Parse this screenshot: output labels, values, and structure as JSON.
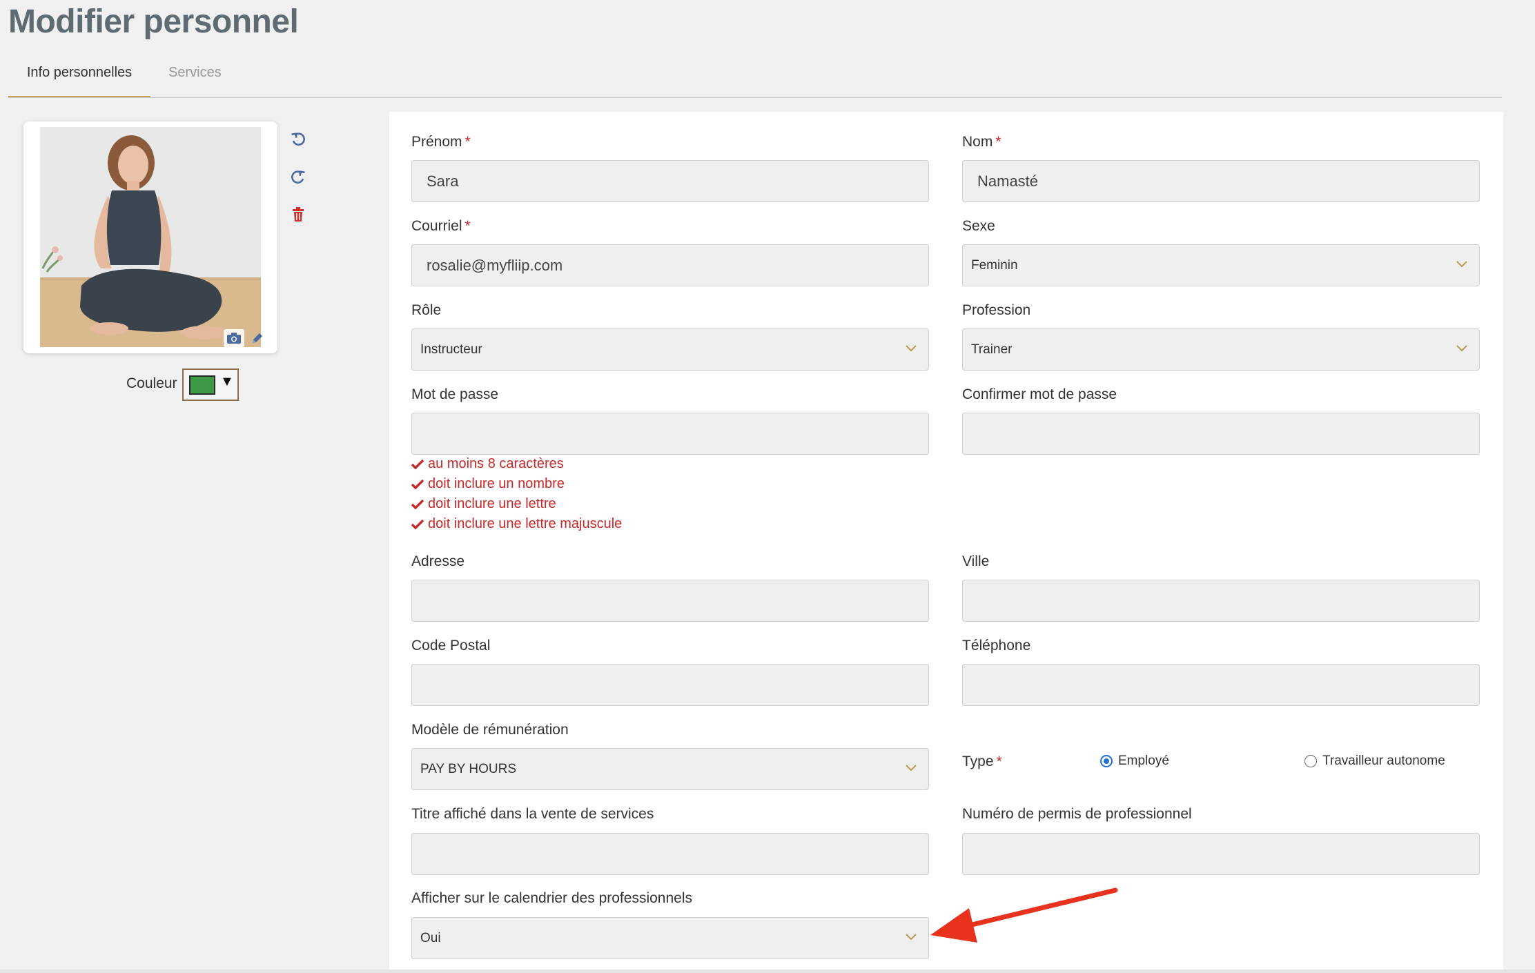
{
  "page_title": "Modifier personnel",
  "tabs": [
    {
      "label": "Info personnelles",
      "active": true
    },
    {
      "label": "Services",
      "active": false
    }
  ],
  "photo": {
    "icons": [
      "rotate-left-icon",
      "rotate-right-icon",
      "trash-icon",
      "camera-icon",
      "pencil-icon"
    ]
  },
  "couleur": {
    "label": "Couleur",
    "value": "#3f9a48"
  },
  "form": {
    "prenom": {
      "label": "Prénom",
      "required_mark": "*",
      "value": "Sara"
    },
    "nom": {
      "label": "Nom",
      "required_mark": "*",
      "value": "Namasté"
    },
    "courriel": {
      "label": "Courriel",
      "required_mark": "*",
      "value": "rosalie@myfliip.com"
    },
    "sexe": {
      "label": "Sexe",
      "value": "Feminin"
    },
    "role": {
      "label": "Rôle",
      "value": "Instructeur"
    },
    "profession": {
      "label": "Profession",
      "value": "Trainer"
    },
    "mot_de_passe": {
      "label": "Mot de passe",
      "value": ""
    },
    "confirmer_mot_de_passe": {
      "label": "Confirmer mot de passe",
      "value": ""
    },
    "password_rules": [
      "au moins 8 caractères",
      "doit inclure un nombre",
      "doit inclure une lettre",
      "doit inclure une lettre majuscule"
    ],
    "adresse": {
      "label": "Adresse",
      "value": ""
    },
    "ville": {
      "label": "Ville",
      "value": ""
    },
    "code_postal": {
      "label": "Code Postal",
      "value": ""
    },
    "telephone": {
      "label": "Téléphone",
      "value": ""
    },
    "modele_remuneration": {
      "label": "Modèle de rémunération",
      "value": "PAY BY HOURS"
    },
    "type": {
      "label": "Type",
      "required_mark": "*",
      "options": [
        {
          "label": "Employé",
          "selected": true
        },
        {
          "label": "Travailleur autonome",
          "selected": false
        }
      ]
    },
    "titre_affiche": {
      "label": "Titre affiché dans la vente de services",
      "value": ""
    },
    "numero_permis": {
      "label": "Numéro de permis de professionnel",
      "value": ""
    },
    "afficher_calendrier": {
      "label": "Afficher sur le calendrier des professionnels",
      "value": "Oui"
    }
  },
  "colors": {
    "accent": "#c8a455",
    "error": "#c62828",
    "radio_selected": "#1e6fd9",
    "annotation_arrow": "#e8321e"
  }
}
